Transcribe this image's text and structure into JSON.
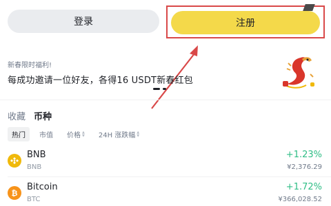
{
  "auth": {
    "login_label": "登录",
    "register_label": "注册"
  },
  "promo": {
    "tag": "新春限时福利!",
    "text": "每成功邀请一位好友，各得16 USDT新春红包"
  },
  "tabs": {
    "favorites": "收藏",
    "coins": "币种"
  },
  "filters": {
    "hot": "热门",
    "market_cap": "市值",
    "price": "价格",
    "change_24h": "24H 涨跌幅"
  },
  "coins": [
    {
      "name": "BNB",
      "symbol": "BNB",
      "change": "+1.23%",
      "price": "¥2,376.29",
      "icon": "bnb-icon"
    },
    {
      "name": "Bitcoin",
      "symbol": "BTC",
      "change": "+1.72%",
      "price": "¥366,028.52",
      "icon": "bitcoin-icon"
    }
  ],
  "colors": {
    "accent": "#f4d94a",
    "highlight_box": "#d94848",
    "positive": "#2ebd85"
  }
}
